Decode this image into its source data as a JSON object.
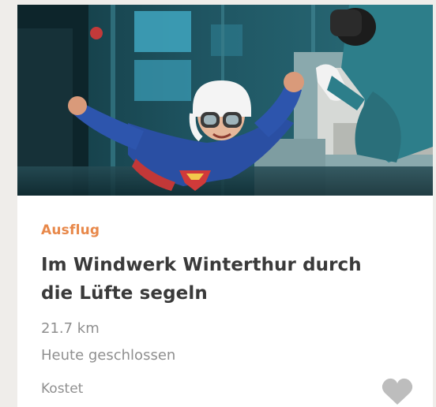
{
  "card": {
    "category": "Ausflug",
    "title": "Im Windwerk Winterthur durch die Lüfte segeln",
    "distance": "21.7 km",
    "opening_status": "Heute geschlossen",
    "price": "Kostet",
    "favorite_icon": "heart-icon",
    "image_alt": "Kind im Superman-Anzug fliegt im Windkanal mit Instruktor"
  },
  "colors": {
    "accent": "#e8884a",
    "title": "#3a3a3a",
    "meta": "#8f8f8f",
    "heart": "#bdbdbd"
  }
}
